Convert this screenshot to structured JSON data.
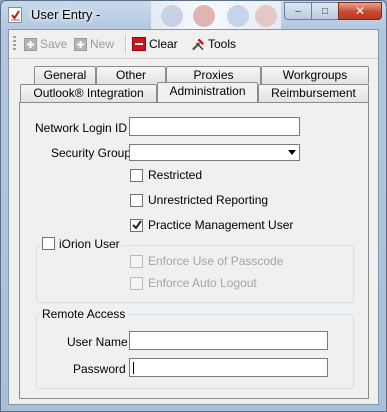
{
  "window": {
    "title": "User Entry -",
    "controls": {
      "minimize": "–",
      "maximize": "□",
      "close": "✕"
    }
  },
  "toolbar": {
    "save_label": "Save",
    "new_label": "New",
    "clear_label": "Clear",
    "tools_label": "Tools"
  },
  "tabs": {
    "row1": [
      "General",
      "Other",
      "Proxies",
      "Workgroups"
    ],
    "row2": [
      "Outlook® Integration",
      "Administration",
      "Reimbursement"
    ],
    "active": "Administration"
  },
  "admin": {
    "network_login_label": "Network Login ID",
    "network_login_value": "",
    "security_group_label": "Security Group",
    "security_group_value": "",
    "restricted": {
      "label": "Restricted",
      "checked": false
    },
    "unrestricted_reporting": {
      "label": "Unrestricted Reporting",
      "checked": false
    },
    "practice_management": {
      "label": "Practice Management User",
      "checked": true
    },
    "iorion": {
      "label": "iOrion User",
      "checked": false,
      "enforce_passcode": {
        "label": "Enforce Use of Passcode",
        "checked": false,
        "enabled": false
      },
      "enforce_logout": {
        "label": "Enforce Auto Logout",
        "checked": false,
        "enabled": false
      }
    },
    "remote_access": {
      "legend": "Remote Access",
      "user_name_label": "User Name",
      "user_name_value": "",
      "password_label": "Password",
      "password_value": ""
    }
  },
  "colors": {
    "close_button": "#c94a31",
    "clear_icon": "#d0121b",
    "disabled_text": "#a5a5a5"
  }
}
